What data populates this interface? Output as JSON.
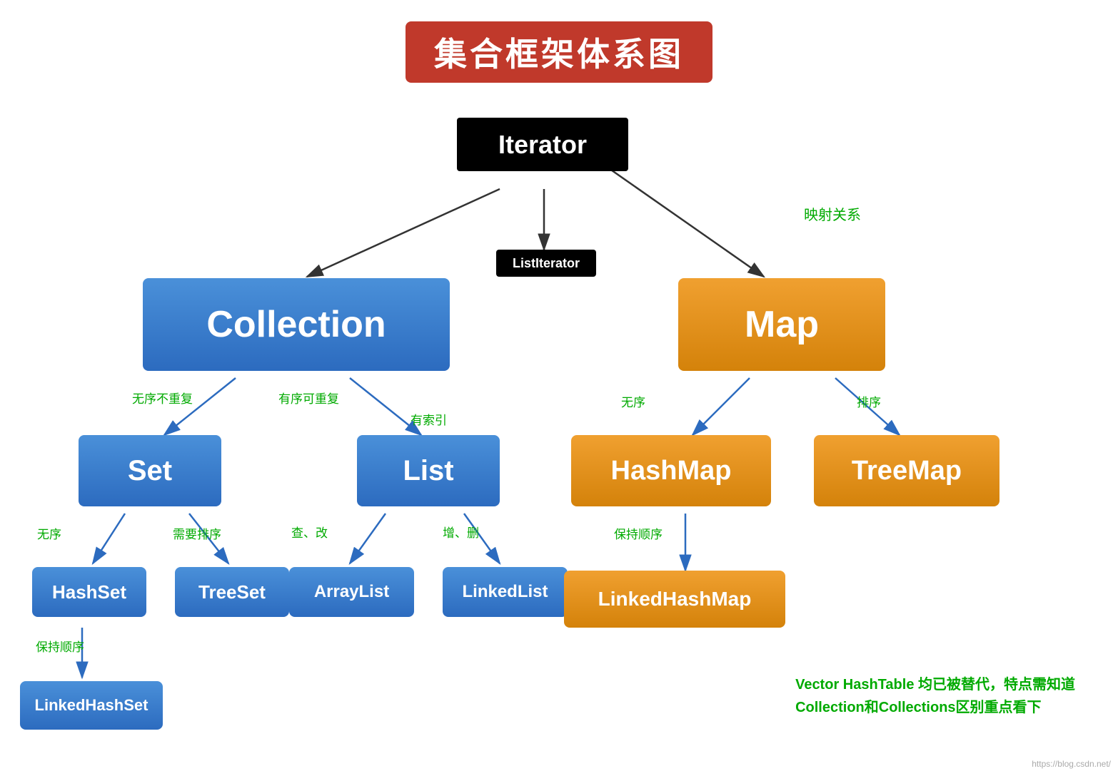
{
  "title": "集合框架体系图",
  "nodes": {
    "iterator": {
      "label": "Iterator",
      "type": "black"
    },
    "listIterator": {
      "label": "ListIterator",
      "type": "black"
    },
    "collection": {
      "label": "Collection",
      "type": "blue"
    },
    "map": {
      "label": "Map",
      "type": "orange"
    },
    "set": {
      "label": "Set",
      "type": "blue"
    },
    "list": {
      "label": "List",
      "type": "blue"
    },
    "hashMap": {
      "label": "HashMap",
      "type": "orange"
    },
    "treeMap": {
      "label": "TreeMap",
      "type": "orange"
    },
    "hashSet": {
      "label": "HashSet",
      "type": "blue"
    },
    "treeSet": {
      "label": "TreeSet",
      "type": "blue"
    },
    "arrayList": {
      "label": "ArrayList",
      "type": "blue"
    },
    "linkedList": {
      "label": "LinkedList",
      "type": "blue"
    },
    "linkedHashMap": {
      "label": "LinkedHashMap",
      "type": "orange"
    },
    "linkedHashSet": {
      "label": "LinkedHashSet",
      "type": "blue"
    }
  },
  "labels": {
    "mappingRelation": "映射关系",
    "unorderedNoDup": "无序不重复",
    "orderedDup": "有序可重复",
    "withIndex": "有索引",
    "unordered": "无序",
    "sort": "排序",
    "noOrder": "无序",
    "needSort": "需要排序",
    "queryModify": "查、改",
    "addDelete": "增、删",
    "keepOrder": "保持顺序",
    "keepOrder2": "保持顺序"
  },
  "footerNotes": {
    "line1": "Vector HashTable 均已被替代，特点需知道",
    "line2": "Collection和Collections区别重点看下"
  },
  "watermark": "https://blog.csdn.net/"
}
